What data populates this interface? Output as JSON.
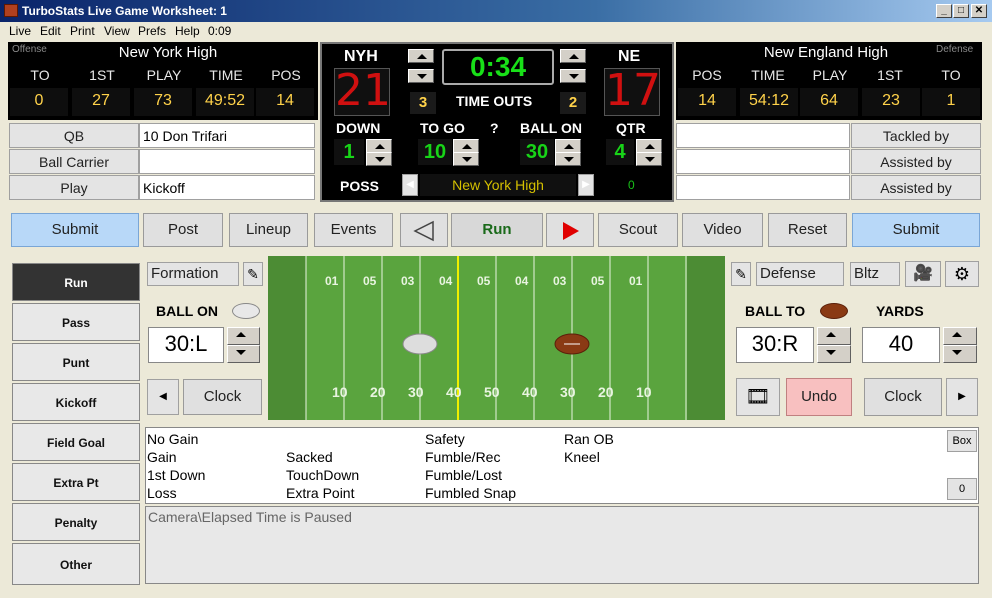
{
  "window": {
    "title": "TurboStats Live Game Worksheet: 1",
    "min": "_",
    "max": "□",
    "close": "✕"
  },
  "menu": [
    "Live",
    "Edit",
    "Print",
    "View",
    "Prefs",
    "Help",
    "0:09"
  ],
  "offense": {
    "role": "Offense",
    "team": "New York High",
    "cols": [
      "TO",
      "1ST",
      "PLAY",
      "TIME",
      "POS"
    ],
    "vals": [
      "0",
      "27",
      "73",
      "49:52",
      "14"
    ]
  },
  "defense": {
    "role": "Defense",
    "team": "New England High",
    "cols": [
      "POS",
      "TIME",
      "PLAY",
      "1ST",
      "TO"
    ],
    "vals": [
      "14",
      "54:12",
      "64",
      "23",
      "1"
    ]
  },
  "score": {
    "home_abbr": "NYH",
    "home": "21",
    "away_abbr": "NE",
    "away": "17",
    "clock": "0:34",
    "timeouts_label": "TIME OUTS",
    "home_to": "3",
    "away_to": "2",
    "down_label": "DOWN",
    "down": "1",
    "togo_label": "TO GO",
    "togo": "10",
    "q": "?",
    "ballon_label": "BALL ON",
    "ballon": "30",
    "qtr_label": "QTR",
    "qtr": "4",
    "poss_label": "POSS",
    "poss": "New York High",
    "poss_n": "0"
  },
  "left_players": [
    {
      "label": "QB",
      "value": "10 Don Trifari"
    },
    {
      "label": "Ball Carrier",
      "value": ""
    },
    {
      "label": "Play",
      "value": "Kickoff"
    }
  ],
  "right_players": [
    {
      "label": "Tackled by",
      "value": ""
    },
    {
      "label": "Assisted by",
      "value": ""
    },
    {
      "label": "Assisted by",
      "value": ""
    }
  ],
  "toolbar": {
    "submit": "Submit",
    "post": "Post",
    "lineup": "Lineup",
    "events": "Events",
    "run": "Run",
    "scout": "Scout",
    "video": "Video",
    "reset": "Reset",
    "submit2": "Submit"
  },
  "plays": [
    "Run",
    "Pass",
    "Punt",
    "Kickoff",
    "Field Goal",
    "Extra Pt",
    "Penalty",
    "Other"
  ],
  "left_ctrl": {
    "formation": "Formation",
    "ball_on_label": "BALL ON",
    "ball_on": "30:L",
    "clock": "Clock"
  },
  "right_ctrl": {
    "defense": "Defense",
    "bltz": "Bltz",
    "ball_to_label": "BALL TO",
    "ball_to": "30:R",
    "yards_label": "YARDS",
    "yards": "40",
    "undo": "Undo",
    "clock": "Clock"
  },
  "yard_top": [
    "01",
    "05",
    "03",
    "04",
    "05",
    "04",
    "03",
    "05",
    "01"
  ],
  "yard_bot": [
    "10",
    "20",
    "30",
    "40",
    "50",
    "40",
    "30",
    "20",
    "10"
  ],
  "results": {
    "col1": [
      "No Gain",
      "Gain",
      "1st Down",
      "Loss"
    ],
    "col2": [
      "",
      "Sacked",
      "TouchDown",
      "Extra Point"
    ],
    "col3": [
      "Safety",
      "Fumble/Rec",
      "Fumble/Lost",
      "Fumbled Snap"
    ],
    "col4": [
      "Ran OB",
      "Kneel"
    ],
    "box": "Box",
    "count": "0"
  },
  "status": "Camera\\Elapsed Time is Paused"
}
